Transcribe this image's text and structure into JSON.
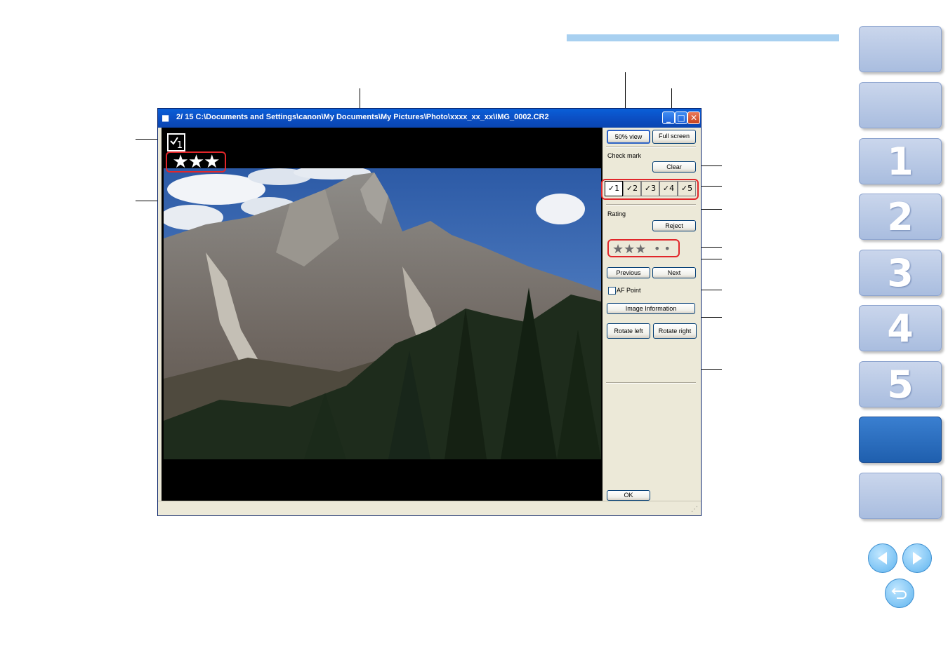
{
  "window": {
    "title": "2/ 15  C:\\Documents and Settings\\canon\\My Documents\\My Pictures\\Photo\\xxxx_xx_xx\\IMG_0002.CR2",
    "minimize_glyph": "_",
    "maximize_glyph": "□",
    "close_glyph": "✕"
  },
  "viewer": {
    "check_overlay_number": "1",
    "star_overlay": "★★★"
  },
  "panel": {
    "view_50_label": "50% view",
    "full_screen_label": "Full screen",
    "check_mark_label": "Check mark",
    "clear_label": "Clear",
    "check_buttons": [
      "1",
      "2",
      "3",
      "4",
      "5"
    ],
    "rating_label": "Rating",
    "reject_label": "Reject",
    "rating_stars": "★★★",
    "rating_dots": "• •",
    "previous_label": "Previous",
    "next_label": "Next",
    "af_point_label": "AF Point",
    "image_info_label": "Image Information",
    "rotate_left_label": "Rotate left",
    "rotate_right_label": "Rotate right",
    "ok_label": "OK"
  },
  "navigation": {
    "tabs": [
      "",
      "",
      "1",
      "2",
      "3",
      "4",
      "5",
      "",
      ""
    ],
    "active_tab_index": 7
  },
  "colors": {
    "accent_bar": "#a8d0f0",
    "highlight_red": "#e1262a",
    "nav_active": "#2a6fc2"
  }
}
